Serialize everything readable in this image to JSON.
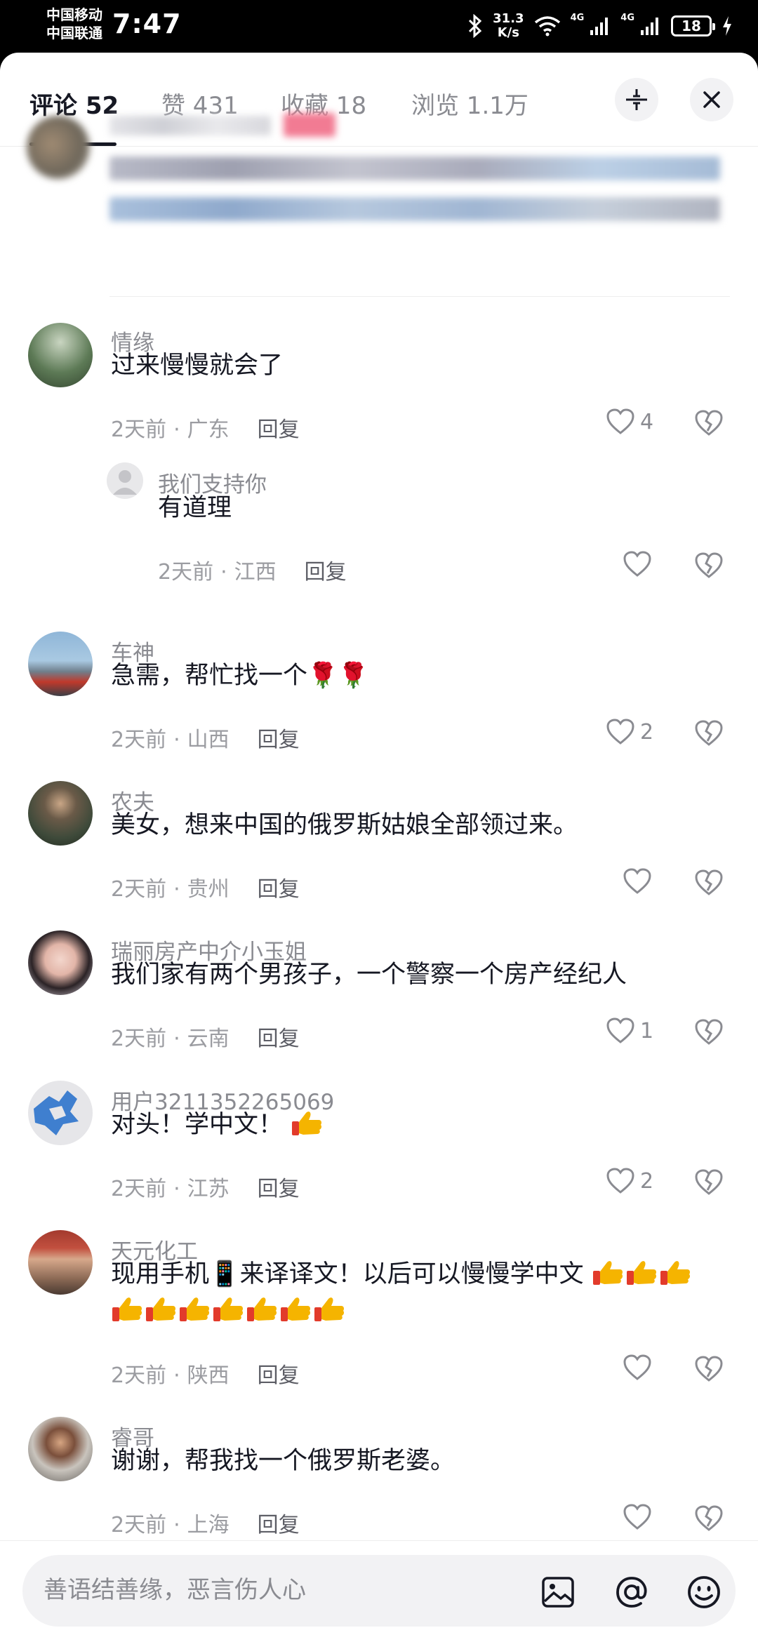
{
  "status_bar": {
    "carrier_1": "中国移动",
    "carrier_2": "中国联通",
    "time": "7:47",
    "speed_value": "31.3",
    "speed_unit": "K/s",
    "net_1": "4G",
    "net_2": "4G",
    "battery": "18"
  },
  "tabs": [
    {
      "label": "评论 52"
    },
    {
      "label": "赞 431"
    },
    {
      "label": "收藏 18"
    },
    {
      "label": "浏览 1.1万"
    }
  ],
  "comments": [
    {
      "user": "情缘",
      "text": "过来慢慢就会了",
      "time": "2天前",
      "location": "广东",
      "reply": "回复",
      "likes": "4"
    },
    {
      "user": "我们支持你",
      "text": "有道理",
      "time": "2天前",
      "location": "江西",
      "reply": "回复",
      "likes": ""
    },
    {
      "user": "车神",
      "text": "急需，帮忙找一个🌹🌹",
      "time": "2天前",
      "location": "山西",
      "reply": "回复",
      "likes": "2"
    },
    {
      "user": "农夫",
      "text": "美女，想来中国的俄罗斯姑娘全部领过来。",
      "time": "2天前",
      "location": "贵州",
      "reply": "回复",
      "likes": ""
    },
    {
      "user": "瑞丽房产中介小玉姐",
      "text": "我们家有两个男孩子，一个警察一个房产经纪人",
      "time": "2天前",
      "location": "云南",
      "reply": "回复",
      "likes": "1"
    },
    {
      "user": "用户3211352265069",
      "text": "对头！学中文！",
      "time": "2天前",
      "location": "江苏",
      "reply": "回复",
      "likes": "2"
    },
    {
      "user": "天元化工",
      "text": "现用手机📱来译译文！以后可以慢慢学中文",
      "time": "2天前",
      "location": "陕西",
      "reply": "回复",
      "likes": ""
    },
    {
      "user": "睿哥",
      "text": "谢谢，帮我找一个俄罗斯老婆。",
      "time": "2天前",
      "location": "上海",
      "reply": "回复",
      "likes": ""
    }
  ],
  "composer": {
    "placeholder": "善语结善缘，恶言伤人心"
  },
  "icons": {
    "close": "close-icon",
    "collapse": "collapse-icon",
    "like": "heart-icon",
    "dislike": "broken-heart-icon",
    "image": "image-icon",
    "mention": "at-icon",
    "emoji": "emoji-icon"
  },
  "colors": {
    "thumb": "#f5b400",
    "thumb_cuff": "#e23b2b",
    "text": "#161823",
    "muted": "#8a8b91"
  }
}
